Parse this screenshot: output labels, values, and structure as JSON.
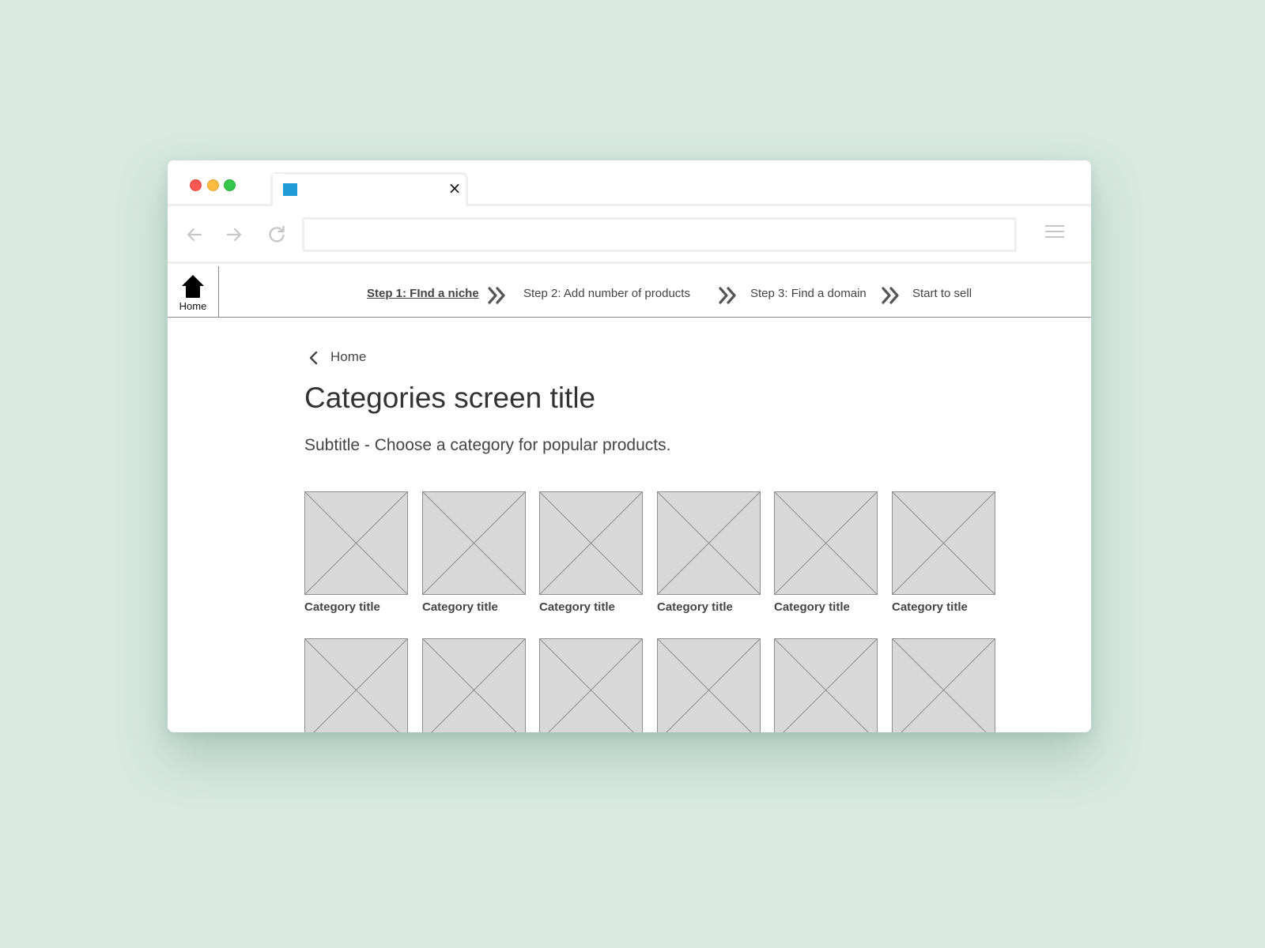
{
  "browser": {
    "tab": {
      "close_icon": "close-icon",
      "favicon_color": "#219bd6"
    },
    "url": "",
    "controls": {
      "back_icon": "arrow-left-icon",
      "forward_icon": "arrow-right-icon",
      "reload_icon": "reload-icon",
      "menu_icon": "hamburger-menu-icon"
    }
  },
  "stepbar": {
    "home_label": "Home",
    "steps": [
      {
        "label": "Step 1: FInd a niche",
        "active": true
      },
      {
        "label": "Step 2: Add number of products",
        "active": false
      },
      {
        "label": "Step 3: Find a domain",
        "active": false
      },
      {
        "label": "Start to sell",
        "active": false
      }
    ]
  },
  "breadcrumb": {
    "back_label": "Home"
  },
  "page": {
    "title": "Categories screen title",
    "subtitle": "Subtitle - Choose a category for popular products."
  },
  "categories": {
    "rows": [
      [
        "Category title",
        "Category title",
        "Category title",
        "Category title",
        "Category title",
        "Category title"
      ],
      [
        "",
        "",
        "",
        "",
        "",
        ""
      ]
    ]
  },
  "colors": {
    "background": "#d7e9e1",
    "placeholder_fill": "#d8d8d8",
    "placeholder_stroke": "#8e8e8e",
    "traffic_red": "#fc5753",
    "traffic_yellow": "#fdbc40",
    "traffic_green": "#34c84a"
  }
}
